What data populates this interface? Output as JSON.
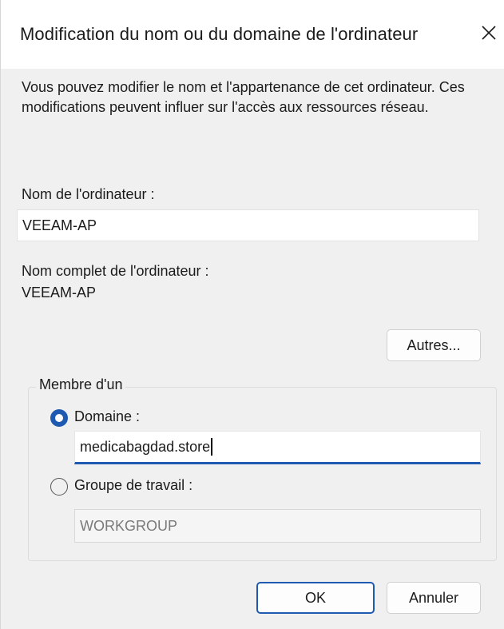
{
  "window": {
    "title": "Modification du nom ou du domaine de l'ordinateur"
  },
  "description": "Vous pouvez modifier le nom et l'appartenance de cet ordinateur. Ces modifications peuvent influer sur l'accès aux ressources réseau.",
  "computer_name": {
    "label": "Nom de l'ordinateur :",
    "value": "VEEAM-AP"
  },
  "full_name": {
    "label": "Nom complet de l'ordinateur :",
    "value": "VEEAM-AP"
  },
  "buttons": {
    "more": "Autres...",
    "ok": "OK",
    "cancel": "Annuler"
  },
  "membership": {
    "legend": "Membre d'un",
    "domain": {
      "label": "Domaine :",
      "value": "medicabagdad.store",
      "selected": true
    },
    "workgroup": {
      "label": "Groupe de travail :",
      "value": "WORKGROUP",
      "selected": false
    }
  },
  "colors": {
    "accent": "#1e5bb0",
    "dialog_bg": "#f0f0f0",
    "titlebar_bg": "#ffffff"
  },
  "icons": {
    "close": "close-icon"
  }
}
